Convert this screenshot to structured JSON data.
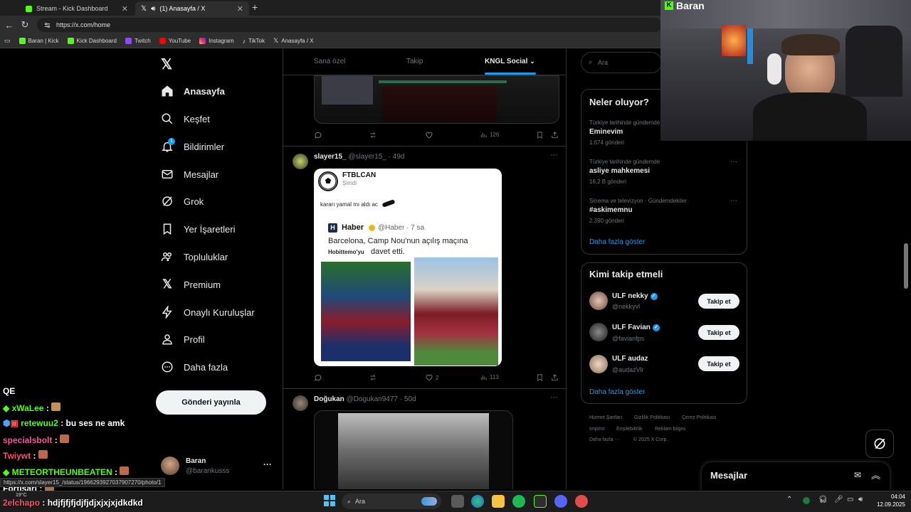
{
  "browser": {
    "tabs": [
      {
        "label": "Stream - Kick Dashboard",
        "active": false
      },
      {
        "label": "(1) Anasayfa / X",
        "active": true
      }
    ],
    "url": "https://x.com/home",
    "bookmarks": [
      "Baran | Kick",
      "Kick Dashboard",
      "Twitch",
      "YouTube",
      "Instagram",
      "TikTok",
      "Anasayfa / X"
    ],
    "status_url": "https://x.com/slayer15_/status/1966293927037907270/photo/1"
  },
  "sidebar": {
    "items": [
      {
        "label": "Anasayfa",
        "icon": "home-icon"
      },
      {
        "label": "Keşfet",
        "icon": "search-icon"
      },
      {
        "label": "Bildirimler",
        "icon": "bell-icon",
        "badge": "1"
      },
      {
        "label": "Mesajlar",
        "icon": "mail-icon"
      },
      {
        "label": "Grok",
        "icon": "grok-icon"
      },
      {
        "label": "Yer İşaretleri",
        "icon": "bookmark-icon"
      },
      {
        "label": "Topluluklar",
        "icon": "communities-icon"
      },
      {
        "label": "Premium",
        "icon": "x-logo-icon"
      },
      {
        "label": "Onaylı Kuruluşlar",
        "icon": "lightning-icon"
      },
      {
        "label": "Profil",
        "icon": "person-icon"
      },
      {
        "label": "Daha fazla",
        "icon": "more-circle-icon"
      }
    ],
    "post_button": "Gönderi yayınla",
    "account": {
      "name": "Baran",
      "handle": "@barankusss"
    }
  },
  "feed": {
    "tabs": [
      "Sana özel",
      "Takip",
      "KNGL Social"
    ],
    "top_tweet_views": "126",
    "tweet1": {
      "name": "slayer15_",
      "handle": "@slayer15_",
      "time": "49d",
      "quoted_account": "FTBLCAN",
      "quoted_time": "Şimdi",
      "quoted_text": "kararı yamal mı aldı ac",
      "inner_account": "Haber",
      "inner_handle": "@Haber",
      "inner_time": "7 sa",
      "inner_text": "Barcelona, Camp Nou'nun açılış maçına",
      "inner_text2": "davet etti.",
      "inner_overlay": "Hobittemo'yu",
      "likes": "2",
      "views": "113"
    },
    "tweet2": {
      "name": "Doğukan",
      "handle": "@Dogukan9477",
      "time": "50d"
    }
  },
  "right": {
    "search_placeholder": "Ara",
    "trends_title": "Neler oluyor?",
    "trends": [
      {
        "meta": "Türkiye tarihinde gündemde",
        "name": "Eminevim",
        "count": "1.674 gönderi"
      },
      {
        "meta": "Türkiye tarihinde gündemde",
        "name": "asliye mahkemesi",
        "count": "16,2 B gönderi"
      },
      {
        "meta": "Sinema ve televizyon · Gündemdekiler",
        "name": "#askimemnu",
        "count": "2.390 gönderi"
      }
    ],
    "show_more": "Daha fazla göster",
    "who_title": "Kimi takip etmeli",
    "suggestions": [
      {
        "name": "ULF nekky",
        "handle": "@nekkyvl"
      },
      {
        "name": "ULF Favian",
        "handle": "@favianfps"
      },
      {
        "name": "ULF audaz",
        "handle": "@audazVlr"
      }
    ],
    "follow_label": "Takip et",
    "footer": [
      "Hizmet Şartları",
      "Gizlilik Politikası",
      "Çerez Politikası",
      "Imprint",
      "Erişilebilirlik",
      "Reklam bilgisi",
      "Daha fazla ···",
      "© 2025 X Corp."
    ],
    "messages_label": "Mesajlar"
  },
  "stream": {
    "channel_name": "Baran",
    "chat": [
      {
        "user": "QE",
        "msg": ""
      },
      {
        "user": "xWaLee",
        "msg": ":"
      },
      {
        "user": "retewuu2",
        "msg": ": bu ses ne amk"
      },
      {
        "user": "specialsbolt",
        "msg": ":"
      },
      {
        "user": "Twiywt",
        "msg": ":"
      },
      {
        "user": "METEORTHEUNBEATEN",
        "msg": ":"
      },
      {
        "user": "Fortisari",
        "msg": ":"
      },
      {
        "user": "2elchapo",
        "msg": ": hdjfjfjfjdjfjdjxjxjxjdkdkd"
      }
    ]
  },
  "taskbar": {
    "search": "Ara",
    "weather": "19°C",
    "time": "04:04",
    "date": "12.09.2025"
  }
}
